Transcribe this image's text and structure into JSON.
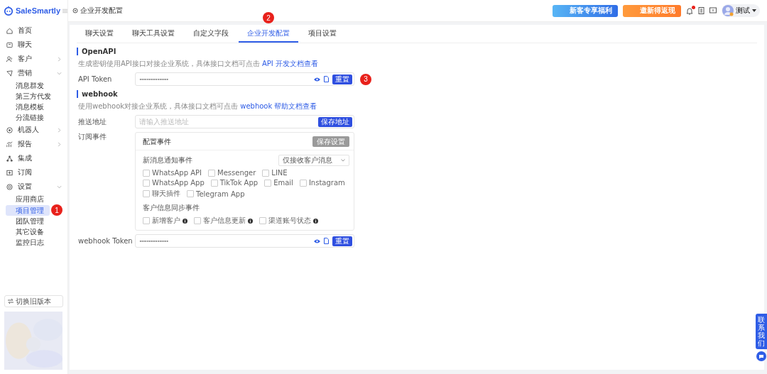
{
  "header": {
    "brand": "SaleSmartly",
    "breadcrumb": "企业开发配置",
    "promos": [
      {
        "label": "新客专享福利",
        "kind": "blue"
      },
      {
        "label": "邀新得返现",
        "kind": "orange"
      }
    ],
    "notifications": {
      "unread": true
    },
    "user": {
      "name": "测试"
    }
  },
  "sidebar": {
    "items": [
      {
        "label": "首页"
      },
      {
        "label": "聊天"
      },
      {
        "label": "客户",
        "expanded": false
      },
      {
        "label": "营销",
        "expanded": true,
        "children": [
          {
            "label": "消息群发",
            "selected": false
          },
          {
            "label": "第三方代发",
            "selected": false
          },
          {
            "label": "消息模板",
            "selected": false
          },
          {
            "label": "分流链接",
            "selected": false
          }
        ]
      },
      {
        "label": "机器人",
        "expanded": false
      },
      {
        "label": "报告",
        "expanded": false
      },
      {
        "label": "集成"
      },
      {
        "label": "订阅"
      },
      {
        "label": "设置",
        "expanded": true,
        "children": [
          {
            "label": "应用商店",
            "selected": false
          },
          {
            "label": "项目管理",
            "selected": true,
            "marker": "1"
          },
          {
            "label": "团队管理",
            "selected": false
          },
          {
            "label": "其它设备",
            "selected": false
          },
          {
            "label": "监控日志",
            "selected": false
          }
        ]
      }
    ],
    "switch_button": "切换旧版本"
  },
  "tabs": [
    {
      "label": "聊天设置",
      "selected": false
    },
    {
      "label": "聊天工具设置",
      "selected": false
    },
    {
      "label": "自定义字段",
      "selected": false
    },
    {
      "label": "企业开发配置",
      "selected": true,
      "marker": "2"
    },
    {
      "label": "项目设置",
      "selected": false
    }
  ],
  "openapi": {
    "title": "OpenAPI",
    "description": "生成密钥使用API接口对接企业系统，具体接口文档可点击 ",
    "link": "API 开发文档查看",
    "token_label": "API Token",
    "token_value": "••••••••••••••••",
    "reset_button": "重置",
    "marker": "3"
  },
  "webhook": {
    "title": "webhook",
    "description": "使用webhook对接企业系统，具体接口文档可点击 ",
    "link": "webhook 帮助文档查看",
    "url_label": "推送地址",
    "url_placeholder": "请输入推送地址",
    "save_url_button": "保存地址",
    "events_label": "订阅事件",
    "events_card": {
      "title": "配置事件",
      "save_button": {
        "label": "保存设置",
        "disabled": true
      },
      "message_group": {
        "title": "新消息通知事件",
        "filter": "仅接收客户消息",
        "options": [
          {
            "label": "WhatsApp API",
            "checked": false
          },
          {
            "label": "Messenger",
            "checked": false
          },
          {
            "label": "LINE",
            "checked": false
          },
          {
            "label": "WhatsApp App",
            "checked": false
          },
          {
            "label": "TikTok App",
            "checked": false
          },
          {
            "label": "Email",
            "checked": false
          },
          {
            "label": "Instagram",
            "checked": false
          },
          {
            "label": "聊天插件",
            "checked": false
          },
          {
            "label": "Telegram App",
            "checked": false
          }
        ]
      },
      "sync_group": {
        "title": "客户信息同步事件",
        "options": [
          {
            "label": "新增客户",
            "checked": false
          },
          {
            "label": "客户信息更新",
            "checked": false
          },
          {
            "label": "渠道账号状态",
            "checked": false
          }
        ]
      }
    },
    "token_label": "webhook Token",
    "token_value": "••••••••••••••••",
    "reset_button": "重置"
  },
  "contact_tab": "联系我们"
}
